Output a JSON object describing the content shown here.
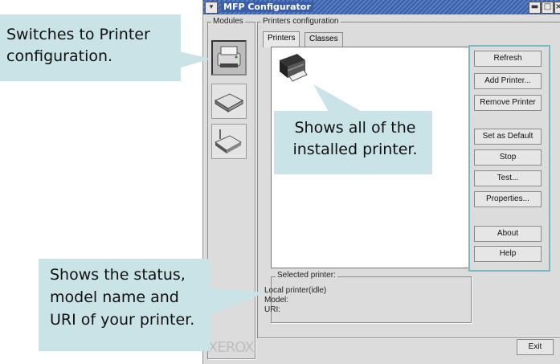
{
  "window": {
    "title": "MFP Configurator",
    "minimize_glyph": "▬",
    "maximize_glyph": "□",
    "close_glyph": "×"
  },
  "modules": {
    "label": "Modules",
    "items": [
      {
        "name": "printer",
        "icon": "printer-icon",
        "active": true
      },
      {
        "name": "scanner",
        "icon": "scanner-icon",
        "active": false
      },
      {
        "name": "port",
        "icon": "port-icon",
        "active": false
      }
    ],
    "brand": "XEROX"
  },
  "printers_config": {
    "label": "Printers configuration",
    "tabs": [
      "Printers",
      "Classes"
    ],
    "active_tab": "Printers"
  },
  "actions": [
    "Refresh",
    "Add Printer...",
    "Remove Printer",
    "Set as Default",
    "Stop",
    "Test...",
    "Properties...",
    "About",
    "Help"
  ],
  "selected_printer": {
    "label": "Selected printer:",
    "status": "Local printer(idle)",
    "model_label": "Model:",
    "uri_label": "URI:"
  },
  "exit_label": "Exit",
  "callouts": {
    "switch": "Switches to Printer configuration.",
    "installed": "Shows all of the installed printer.",
    "status": "Shows the status, model name and URI of your printer."
  },
  "colors": {
    "callout_bg": "#c9e3e7",
    "highlight_border": "#7ab8c4",
    "titlebar": "#3a5fa8"
  }
}
